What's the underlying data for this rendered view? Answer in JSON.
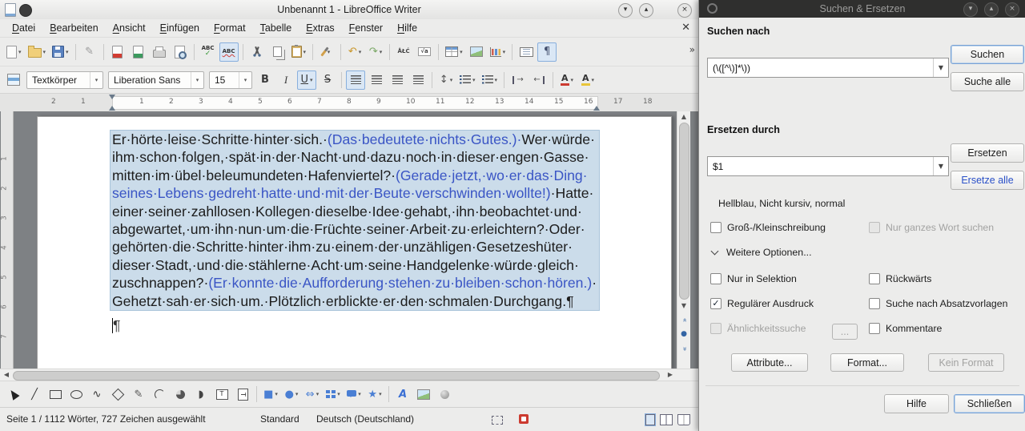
{
  "window": {
    "title": "Unbenannt 1 - LibreOffice Writer",
    "menus": [
      "Datei",
      "Bearbeiten",
      "Ansicht",
      "Einfügen",
      "Format",
      "Tabelle",
      "Extras",
      "Fenster",
      "Hilfe"
    ],
    "controls": [
      {
        "name": "minimize-button",
        "glyph": "▾"
      },
      {
        "name": "maximize-button",
        "glyph": "▴"
      },
      {
        "name": "close-button",
        "glyph": "×"
      }
    ],
    "close_document_glyph": "✕",
    "overflow_glyph": "»"
  },
  "toolbar_main": {
    "items": [
      {
        "name": "new-document-icon",
        "art": "page",
        "dropdown": true
      },
      {
        "name": "open-file-icon",
        "art": "folder",
        "dropdown": true
      },
      {
        "name": "save-icon",
        "art": "floppy",
        "dropdown": true
      },
      {
        "sep": true
      },
      {
        "name": "edit-mode-icon",
        "glyph": "✎",
        "color": "#9a9a9a"
      },
      {
        "sep": true
      },
      {
        "name": "export-pdf-icon",
        "art": "page pdf"
      },
      {
        "name": "export-epub-icon",
        "art": "page epub"
      },
      {
        "name": "print-icon",
        "art": "printer"
      },
      {
        "name": "print-preview-icon",
        "art": "preview"
      },
      {
        "sep": true
      },
      {
        "name": "spelling-icon",
        "art": "abc check",
        "text": "ABC"
      },
      {
        "name": "auto-spellcheck-icon",
        "art": "abc wave",
        "text": "ABC",
        "pressed": true
      },
      {
        "sep": true
      },
      {
        "name": "cut-icon",
        "art": "cut"
      },
      {
        "name": "copy-icon",
        "art": "copy"
      },
      {
        "name": "paste-icon",
        "art": "clipboard",
        "dropdown": true
      },
      {
        "sep": true
      },
      {
        "name": "clone-formatting-icon",
        "art": "brush",
        "dropdown": true
      },
      {
        "sep": true
      },
      {
        "name": "undo-icon",
        "glyph": "↶",
        "color": "#c9962a",
        "dropdown": true
      },
      {
        "name": "redo-icon",
        "glyph": "↷",
        "color": "#7aa866",
        "dropdown": true
      },
      {
        "sep": true
      },
      {
        "name": "special-character-icon",
        "art": "tinytext",
        "text": "ÅŁĆ"
      },
      {
        "name": "insert-formula-icon",
        "art": "tinytext boxed",
        "text": "√a"
      },
      {
        "sep": true
      },
      {
        "name": "insert-table-icon",
        "art": "tbl",
        "dropdown": true
      },
      {
        "name": "insert-image-icon",
        "art": "img"
      },
      {
        "name": "insert-chart-icon",
        "art": "chart",
        "dropdown": true
      },
      {
        "sep": true
      },
      {
        "name": "insert-textbox-icon",
        "art": "textbox"
      },
      {
        "name": "formatting-marks-icon",
        "glyph": "¶",
        "color": "#44506e",
        "pressed": true
      }
    ]
  },
  "toolbar_format": {
    "paragraph_style": "Textkörper",
    "font_name": "Liberation Sans",
    "font_size": "15",
    "items": [
      {
        "name": "bold-icon",
        "glyph": "B",
        "cls": "bold"
      },
      {
        "name": "italic-icon",
        "glyph": "I",
        "cls": "italic"
      },
      {
        "name": "underline-icon",
        "glyph": "U",
        "cls": "underline",
        "dropdown": true,
        "pressed": true
      },
      {
        "name": "strikethrough-icon",
        "glyph": "S",
        "cls": "strike"
      },
      {
        "sep": true
      },
      {
        "name": "align-left-icon",
        "art": "al",
        "pressed": true
      },
      {
        "name": "align-center-icon",
        "art": "al"
      },
      {
        "name": "align-right-icon",
        "art": "al"
      },
      {
        "name": "align-justify-icon",
        "art": "al"
      },
      {
        "sep": true
      },
      {
        "name": "line-spacing-icon",
        "glyph": "↕",
        "color": "#555",
        "dropdown": true
      },
      {
        "name": "bullet-list-icon",
        "art": "list",
        "dropdown": true
      },
      {
        "name": "numbered-list-icon",
        "art": "list",
        "dropdown": true
      },
      {
        "sep": true
      },
      {
        "name": "increase-indent-icon",
        "art": "ind inc",
        "glyph": "→",
        "color": "#555"
      },
      {
        "name": "decrease-indent-icon",
        "art": "ind dec",
        "glyph": "←",
        "color": "#555"
      },
      {
        "sep": true
      },
      {
        "name": "font-color-icon",
        "art": "fontcolor",
        "text": "A",
        "dropdown": true
      },
      {
        "name": "highlight-color-icon",
        "art": "highlight",
        "text": "A",
        "dropdown": true
      }
    ]
  },
  "ruler": {
    "left_labels": [
      "2",
      "1"
    ],
    "labels": [
      "1",
      "2",
      "3",
      "4",
      "5",
      "6",
      "7",
      "8",
      "9",
      "10",
      "11",
      "12",
      "13",
      "14",
      "15",
      "16",
      "17",
      "18"
    ],
    "vertical_labels": [
      "1",
      "2",
      "3",
      "4",
      "5",
      "6",
      "7"
    ]
  },
  "document": {
    "colors": {
      "text": "#1c1c1c",
      "blue": "#3a55c5",
      "selection": "#cbdcea"
    },
    "runs": [
      {
        "color": "black",
        "text": "Er·hörte·leise·Schritte·hinter·sich.·"
      },
      {
        "color": "blue",
        "text": "(Das·bedeutete·nichts·Gutes.)·"
      },
      {
        "color": "black",
        "text": "Wer·würde·ihm·schon·folgen,·spät·in·der·Nacht·und·dazu·noch·in·dieser·engen·Gasse·mitten·im·übel·beleumundeten·Hafenviertel?·"
      },
      {
        "color": "blue",
        "text": "(Gerade·jetzt,·wo·er·das·Ding·seines·Lebens·gedreht·hatte·und·mit·der·Beute·verschwinden·wollte!)"
      },
      {
        "color": "black",
        "text": "·Hatte·einer·seiner·zahllosen·Kollegen·dieselbe·Idee·gehabt,·ihn·beobachtet·und·abgewartet,·um·ihn·nun·um·die·Früchte·seiner·Arbeit·zu·erleichtern?·Oder·gehörten·die·Schritte·hinter·ihm·zu·einem·der·unzähligen·Gesetzeshüter·dieser·Stadt,·und·die·stählerne·Acht·um·seine·Handgelenke·würde·gleich·zuschnappen?·"
      },
      {
        "color": "blue",
        "text": "(Er·konnte·die·Aufforderung·stehen·zu·bleiben·schon·hören.)"
      },
      {
        "color": "black",
        "text": "·Gehetzt·sah·er·sich·um.·Plötzlich·erblickte·er·den·schmalen·Durchgang.¶"
      }
    ],
    "paragraph2_mark": "¶"
  },
  "drawing_toolbar": {
    "items": [
      {
        "name": "select-icon",
        "art": "cursor"
      },
      {
        "name": "line-icon",
        "glyph": "╱",
        "color": "#333"
      },
      {
        "name": "rectangle-icon",
        "art": "rect"
      },
      {
        "name": "ellipse-icon",
        "art": "oval"
      },
      {
        "name": "curve-icon",
        "glyph": "∿",
        "color": "#333"
      },
      {
        "name": "polygon-icon",
        "art": "poly"
      },
      {
        "name": "freeform-line-icon",
        "glyph": "✎",
        "color": "#555"
      },
      {
        "name": "arc-icon",
        "art": "arc"
      },
      {
        "name": "ellipse-pie-icon",
        "art": "pie"
      },
      {
        "name": "circle-segment-icon",
        "glyph": "◗",
        "color": "#444"
      },
      {
        "name": "text-box-icon",
        "art": "tbx",
        "text": "T"
      },
      {
        "name": "vertical-text-icon",
        "art": "tbx vt",
        "text": "T"
      },
      {
        "sep": true
      },
      {
        "name": "basic-shapes-icon",
        "glyph": "■",
        "color": "#4a7fd4",
        "dropdown": true
      },
      {
        "name": "symbol-shapes-icon",
        "glyph": "●",
        "color": "#4a7fd4",
        "dropdown": true
      },
      {
        "name": "block-arrows-icon",
        "glyph": "⇔",
        "color": "#4a7fd4",
        "dropdown": true
      },
      {
        "name": "flowchart-icon",
        "art": "flow",
        "dropdown": true
      },
      {
        "name": "callouts-icon",
        "art": "callout",
        "dropdown": true
      },
      {
        "name": "stars-icon",
        "glyph": "★",
        "color": "#4a7fd4",
        "dropdown": true
      },
      {
        "sep": true
      },
      {
        "name": "fontwork-icon",
        "glyph": "A",
        "color": "#3a6fd4",
        "cls": "fontwork"
      },
      {
        "name": "insert-image-icon",
        "art": "img"
      },
      {
        "name": "extrusion-icon",
        "art": "sphere"
      }
    ]
  },
  "statusbar": {
    "page": "Seite 1 / 1",
    "words": "112 Wörter, 727 Zeichen ausgewählt",
    "style": "Standard",
    "language": "Deutsch (Deutschland)"
  },
  "dialog": {
    "title": "Suchen & Ersetzen",
    "search_label": "Suchen nach",
    "search_value": "(\\([^\\)]*\\))",
    "search_button": "Suchen",
    "search_all_button": "Suche alle",
    "replace_label": "Ersetzen durch",
    "replace_value": "$1",
    "replace_button": "Ersetzen",
    "replace_all_button": "Ersetze alle",
    "attributes_info": "Hellblau, Nicht kursiv, normal",
    "more_options": "Weitere Optionen...",
    "options": [
      {
        "label": "Groß-/Kleinschreibung",
        "checked": false,
        "disabled": false,
        "row": 0,
        "col": 0
      },
      {
        "label": "Nur ganzes Wort suchen",
        "checked": false,
        "disabled": true,
        "row": 0,
        "col": 1
      },
      {
        "label": "Nur in Selektion",
        "checked": false,
        "disabled": false,
        "row": 1,
        "col": 0
      },
      {
        "label": "Rückwärts",
        "checked": false,
        "disabled": false,
        "row": 1,
        "col": 1
      },
      {
        "label": "Regulärer Ausdruck",
        "checked": true,
        "disabled": false,
        "row": 2,
        "col": 0
      },
      {
        "label": "Suche nach Absatzvorlagen",
        "checked": false,
        "disabled": false,
        "row": 2,
        "col": 1
      },
      {
        "label": "Ähnlichkeitssuche",
        "checked": false,
        "disabled": true,
        "row": 3,
        "col": 0
      },
      {
        "label": "Kommentare",
        "checked": false,
        "disabled": false,
        "row": 3,
        "col": 1
      }
    ],
    "similarity_dots": "...",
    "attributes_button": "Attribute...",
    "format_button": "Format...",
    "no_format_button": "Kein Format",
    "help_button": "Hilfe",
    "close_button": "Schließen",
    "controls": [
      {
        "name": "minimize-button",
        "glyph": "▾"
      },
      {
        "name": "maximize-button",
        "glyph": "▴"
      },
      {
        "name": "close-button",
        "glyph": "×"
      }
    ]
  }
}
